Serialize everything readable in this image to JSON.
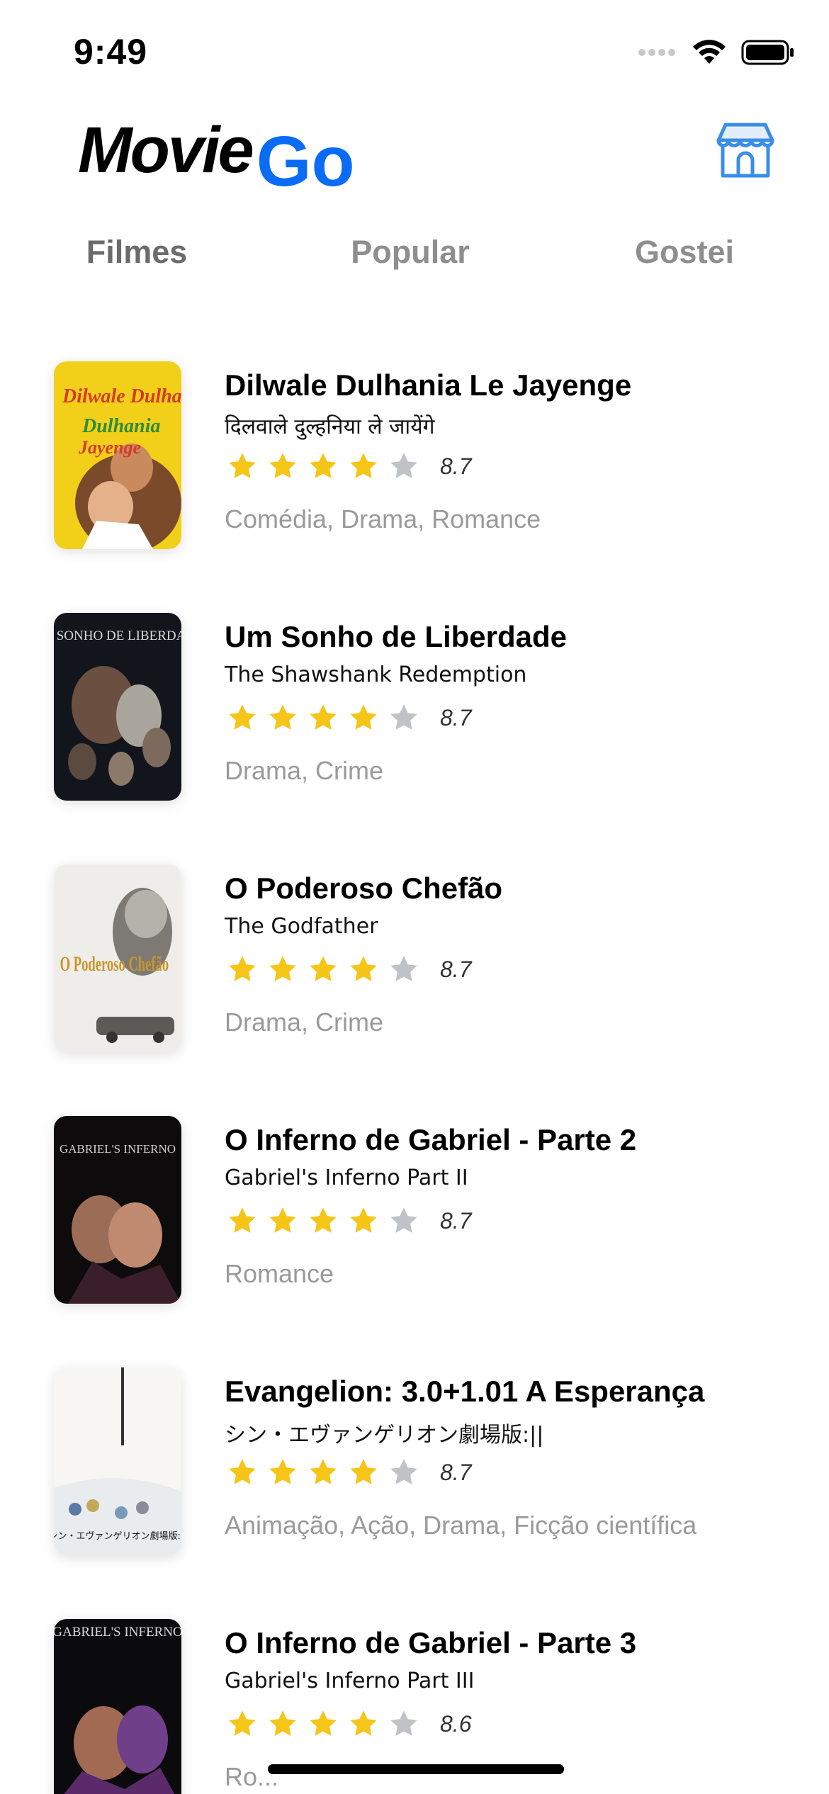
{
  "status_bar": {
    "time": "9:49"
  },
  "header": {
    "logo_part1": "Movie",
    "logo_part2": "Go",
    "store_icon": "storefront-icon",
    "accent_color": "#0a6cf5"
  },
  "tabs": [
    {
      "label": "Filmes",
      "active": true
    },
    {
      "label": "Popular",
      "active": false
    },
    {
      "label": "Gostei",
      "active": false
    }
  ],
  "movies": [
    {
      "title": "Dilwale Dulhania Le Jayenge",
      "original_title": "दिलवाले दुल्हनिया ले जायेंगे",
      "stars": 4,
      "rating": "8.7",
      "genres": "Comédia, Drama, Romance",
      "poster_text": "Dilwale Dulhania Le Jayenge"
    },
    {
      "title": "Um Sonho de Liberdade",
      "original_title": "The Shawshank Redemption",
      "stars": 4,
      "rating": "8.7",
      "genres": "Drama, Crime",
      "poster_text": "UM SONHO DE LIBERDADE"
    },
    {
      "title": "O Poderoso Chefão",
      "original_title": "The Godfather",
      "stars": 4,
      "rating": "8.7",
      "genres": "Drama, Crime",
      "poster_text": "O Poderoso Chefão"
    },
    {
      "title": "O Inferno de Gabriel - Parte 2",
      "original_title": "Gabriel's Inferno Part II",
      "stars": 4,
      "rating": "8.7",
      "genres": "Romance",
      "poster_text": "GABRIEL'S INFERNO"
    },
    {
      "title": "Evangelion: 3.0+1.01 A Esperança",
      "original_title": "シン・エヴァンゲリオン劇場版:||",
      "stars": 4,
      "rating": "8.7",
      "genres": "Animação, Ação, Drama, Ficção científica",
      "poster_text": "シン・エヴァンゲリオン劇場版:||"
    },
    {
      "title": "O Inferno de Gabriel - Parte 3",
      "original_title": "Gabriel's Inferno Part III",
      "stars": 4,
      "rating": "8.6",
      "genres": "Ro...",
      "poster_text": "GABRIEL'S INFERNO"
    }
  ],
  "colors": {
    "star_filled": "#f5c518",
    "star_empty": "#bfc3c8",
    "tab_text": "#8e8e8e",
    "genre_text": "#9a9a9a"
  }
}
